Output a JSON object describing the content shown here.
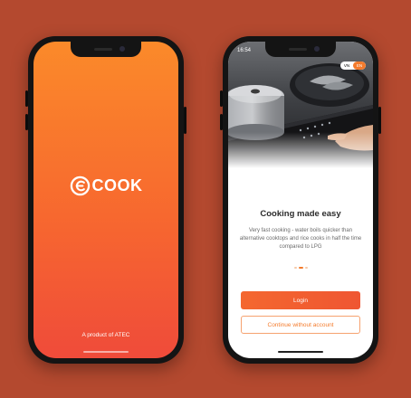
{
  "splash": {
    "brand": "COOK",
    "footer": "A product of ATEC"
  },
  "onboarding": {
    "status_time": "16:54",
    "language": {
      "options": [
        "VN",
        "EN"
      ],
      "selected": "EN"
    },
    "title": "Cooking made easy",
    "description": "Very fast cooking - water boils quicker than alternative cooktops and rice cooks in half the time compared to LPG",
    "pager": {
      "count": 3,
      "active": 1
    },
    "login_label": "Login",
    "continue_label": "Continue without account"
  },
  "colors": {
    "background": "#b4492f",
    "accent": "#f47b2c",
    "primary_button": "#f25d30"
  }
}
